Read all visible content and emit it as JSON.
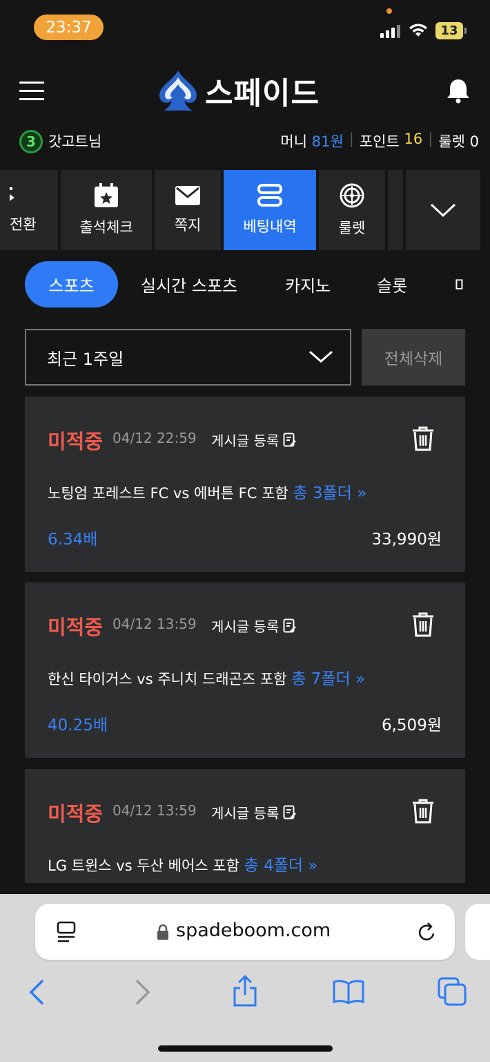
{
  "status_bar": {
    "time": "23:37",
    "battery": "13"
  },
  "header": {
    "logo_text": "스페이드",
    "icons": [
      "menu-icon",
      "spade-logo",
      "bell-icon"
    ]
  },
  "user": {
    "level": "3",
    "name": "갓고트님",
    "money_label": "머니",
    "money_value": "81원",
    "point_label": "포인트",
    "point_value": "16",
    "roulette": "룰렛 0"
  },
  "nav": {
    "items": [
      {
        "label": "전환",
        "icon": "switch-icon"
      },
      {
        "label": "출석체크",
        "icon": "calendar-star-icon"
      },
      {
        "label": "쪽지",
        "icon": "mail-icon"
      },
      {
        "label": "베팅내역",
        "icon": "betting-list-icon",
        "active": true
      },
      {
        "label": "룰렛",
        "icon": "roulette-icon"
      }
    ],
    "more_icon": "chevron-down-icon"
  },
  "categories": [
    "스포츠",
    "실시간 스포츠",
    "카지노",
    "슬롯",
    "미"
  ],
  "filter": {
    "period": "최근 1주일",
    "delete_all": "전체삭제"
  },
  "bets": [
    {
      "status": "미적중",
      "date": "04/12 22:59",
      "post": "게시글 등록",
      "match": "노팅엄 포레스트 FC vs 에버튼 FC 포함",
      "folder": "총 3폴더",
      "odds": "6.34배",
      "amount": "33,990원"
    },
    {
      "status": "미적중",
      "date": "04/12 13:59",
      "post": "게시글 등록",
      "match": "한신 타이거스 vs 주니치 드래곤즈 포함",
      "folder": "총 7폴더",
      "odds": "40.25배",
      "amount": "6,509원"
    },
    {
      "status": "미적중",
      "date": "04/12 13:59",
      "post": "게시글 등록",
      "match": "LG 트윈스 vs 두산 베어스 포함",
      "folder": "총 4폴더"
    }
  ],
  "browser": {
    "url": "spadeboom.com"
  },
  "colors": {
    "accent": "#2f7bf5",
    "lose": "#f05a4f",
    "card": "#2c2d2f",
    "background": "#151515"
  }
}
